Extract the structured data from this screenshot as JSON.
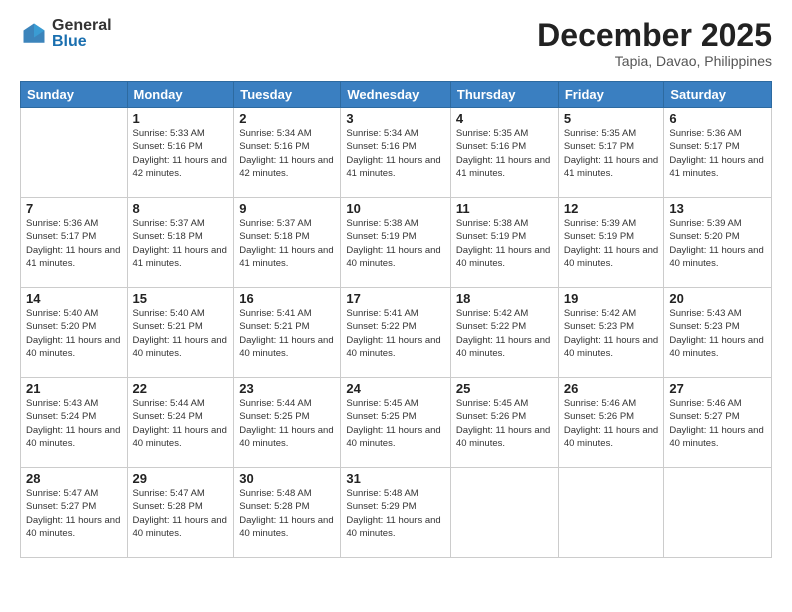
{
  "logo": {
    "general": "General",
    "blue": "Blue"
  },
  "title": "December 2025",
  "subtitle": "Tapia, Davao, Philippines",
  "days_of_week": [
    "Sunday",
    "Monday",
    "Tuesday",
    "Wednesday",
    "Thursday",
    "Friday",
    "Saturday"
  ],
  "weeks": [
    [
      {
        "day": "",
        "sunrise": "",
        "sunset": "",
        "daylight": ""
      },
      {
        "day": "1",
        "sunrise": "Sunrise: 5:33 AM",
        "sunset": "Sunset: 5:16 PM",
        "daylight": "Daylight: 11 hours and 42 minutes."
      },
      {
        "day": "2",
        "sunrise": "Sunrise: 5:34 AM",
        "sunset": "Sunset: 5:16 PM",
        "daylight": "Daylight: 11 hours and 42 minutes."
      },
      {
        "day": "3",
        "sunrise": "Sunrise: 5:34 AM",
        "sunset": "Sunset: 5:16 PM",
        "daylight": "Daylight: 11 hours and 41 minutes."
      },
      {
        "day": "4",
        "sunrise": "Sunrise: 5:35 AM",
        "sunset": "Sunset: 5:16 PM",
        "daylight": "Daylight: 11 hours and 41 minutes."
      },
      {
        "day": "5",
        "sunrise": "Sunrise: 5:35 AM",
        "sunset": "Sunset: 5:17 PM",
        "daylight": "Daylight: 11 hours and 41 minutes."
      },
      {
        "day": "6",
        "sunrise": "Sunrise: 5:36 AM",
        "sunset": "Sunset: 5:17 PM",
        "daylight": "Daylight: 11 hours and 41 minutes."
      }
    ],
    [
      {
        "day": "7",
        "sunrise": "Sunrise: 5:36 AM",
        "sunset": "Sunset: 5:17 PM",
        "daylight": "Daylight: 11 hours and 41 minutes."
      },
      {
        "day": "8",
        "sunrise": "Sunrise: 5:37 AM",
        "sunset": "Sunset: 5:18 PM",
        "daylight": "Daylight: 11 hours and 41 minutes."
      },
      {
        "day": "9",
        "sunrise": "Sunrise: 5:37 AM",
        "sunset": "Sunset: 5:18 PM",
        "daylight": "Daylight: 11 hours and 41 minutes."
      },
      {
        "day": "10",
        "sunrise": "Sunrise: 5:38 AM",
        "sunset": "Sunset: 5:19 PM",
        "daylight": "Daylight: 11 hours and 40 minutes."
      },
      {
        "day": "11",
        "sunrise": "Sunrise: 5:38 AM",
        "sunset": "Sunset: 5:19 PM",
        "daylight": "Daylight: 11 hours and 40 minutes."
      },
      {
        "day": "12",
        "sunrise": "Sunrise: 5:39 AM",
        "sunset": "Sunset: 5:19 PM",
        "daylight": "Daylight: 11 hours and 40 minutes."
      },
      {
        "day": "13",
        "sunrise": "Sunrise: 5:39 AM",
        "sunset": "Sunset: 5:20 PM",
        "daylight": "Daylight: 11 hours and 40 minutes."
      }
    ],
    [
      {
        "day": "14",
        "sunrise": "Sunrise: 5:40 AM",
        "sunset": "Sunset: 5:20 PM",
        "daylight": "Daylight: 11 hours and 40 minutes."
      },
      {
        "day": "15",
        "sunrise": "Sunrise: 5:40 AM",
        "sunset": "Sunset: 5:21 PM",
        "daylight": "Daylight: 11 hours and 40 minutes."
      },
      {
        "day": "16",
        "sunrise": "Sunrise: 5:41 AM",
        "sunset": "Sunset: 5:21 PM",
        "daylight": "Daylight: 11 hours and 40 minutes."
      },
      {
        "day": "17",
        "sunrise": "Sunrise: 5:41 AM",
        "sunset": "Sunset: 5:22 PM",
        "daylight": "Daylight: 11 hours and 40 minutes."
      },
      {
        "day": "18",
        "sunrise": "Sunrise: 5:42 AM",
        "sunset": "Sunset: 5:22 PM",
        "daylight": "Daylight: 11 hours and 40 minutes."
      },
      {
        "day": "19",
        "sunrise": "Sunrise: 5:42 AM",
        "sunset": "Sunset: 5:23 PM",
        "daylight": "Daylight: 11 hours and 40 minutes."
      },
      {
        "day": "20",
        "sunrise": "Sunrise: 5:43 AM",
        "sunset": "Sunset: 5:23 PM",
        "daylight": "Daylight: 11 hours and 40 minutes."
      }
    ],
    [
      {
        "day": "21",
        "sunrise": "Sunrise: 5:43 AM",
        "sunset": "Sunset: 5:24 PM",
        "daylight": "Daylight: 11 hours and 40 minutes."
      },
      {
        "day": "22",
        "sunrise": "Sunrise: 5:44 AM",
        "sunset": "Sunset: 5:24 PM",
        "daylight": "Daylight: 11 hours and 40 minutes."
      },
      {
        "day": "23",
        "sunrise": "Sunrise: 5:44 AM",
        "sunset": "Sunset: 5:25 PM",
        "daylight": "Daylight: 11 hours and 40 minutes."
      },
      {
        "day": "24",
        "sunrise": "Sunrise: 5:45 AM",
        "sunset": "Sunset: 5:25 PM",
        "daylight": "Daylight: 11 hours and 40 minutes."
      },
      {
        "day": "25",
        "sunrise": "Sunrise: 5:45 AM",
        "sunset": "Sunset: 5:26 PM",
        "daylight": "Daylight: 11 hours and 40 minutes."
      },
      {
        "day": "26",
        "sunrise": "Sunrise: 5:46 AM",
        "sunset": "Sunset: 5:26 PM",
        "daylight": "Daylight: 11 hours and 40 minutes."
      },
      {
        "day": "27",
        "sunrise": "Sunrise: 5:46 AM",
        "sunset": "Sunset: 5:27 PM",
        "daylight": "Daylight: 11 hours and 40 minutes."
      }
    ],
    [
      {
        "day": "28",
        "sunrise": "Sunrise: 5:47 AM",
        "sunset": "Sunset: 5:27 PM",
        "daylight": "Daylight: 11 hours and 40 minutes."
      },
      {
        "day": "29",
        "sunrise": "Sunrise: 5:47 AM",
        "sunset": "Sunset: 5:28 PM",
        "daylight": "Daylight: 11 hours and 40 minutes."
      },
      {
        "day": "30",
        "sunrise": "Sunrise: 5:48 AM",
        "sunset": "Sunset: 5:28 PM",
        "daylight": "Daylight: 11 hours and 40 minutes."
      },
      {
        "day": "31",
        "sunrise": "Sunrise: 5:48 AM",
        "sunset": "Sunset: 5:29 PM",
        "daylight": "Daylight: 11 hours and 40 minutes."
      },
      {
        "day": "",
        "sunrise": "",
        "sunset": "",
        "daylight": ""
      },
      {
        "day": "",
        "sunrise": "",
        "sunset": "",
        "daylight": ""
      },
      {
        "day": "",
        "sunrise": "",
        "sunset": "",
        "daylight": ""
      }
    ]
  ]
}
